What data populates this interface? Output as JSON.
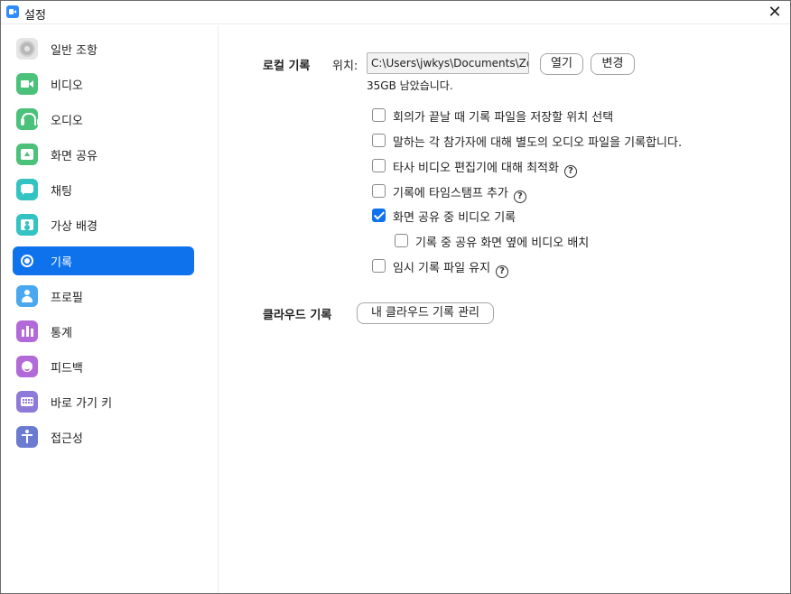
{
  "window": {
    "title": "설정",
    "close_glyph": "✕"
  },
  "sidebar": {
    "items": [
      {
        "label": "일반 조항",
        "icon": "gear-icon",
        "color": "#e5e5e5",
        "active": false
      },
      {
        "label": "비디오",
        "icon": "video-camera-icon",
        "color": "#4bc17a",
        "active": false
      },
      {
        "label": "오디오",
        "icon": "headphones-icon",
        "color": "#4bc17a",
        "active": false
      },
      {
        "label": "화면 공유",
        "icon": "share-screen-icon",
        "color": "#4bc17a",
        "active": false
      },
      {
        "label": "채팅",
        "icon": "chat-bubble-icon",
        "color": "#33c3c3",
        "active": false
      },
      {
        "label": "가상 배경",
        "icon": "virtual-background-icon",
        "color": "#33c3c3",
        "active": false
      },
      {
        "label": "기록",
        "icon": "record-icon",
        "color": "#0e72ed",
        "active": true
      },
      {
        "label": "프로필",
        "icon": "profile-icon",
        "color": "#4aa8f0",
        "active": false
      },
      {
        "label": "통계",
        "icon": "bar-chart-icon",
        "color": "#b26ad8",
        "active": false
      },
      {
        "label": "피드백",
        "icon": "smiley-icon",
        "color": "#b26ad8",
        "active": false
      },
      {
        "label": "바로 가기 키",
        "icon": "keyboard-icon",
        "color": "#8e7ad8",
        "active": false
      },
      {
        "label": "접근성",
        "icon": "accessibility-icon",
        "color": "#6b7bd1",
        "active": false
      }
    ]
  },
  "local_recording": {
    "section_label": "로컬 기록",
    "location_label": "위치:",
    "path_value": "C:\\Users\\jwkys\\Documents\\Zoom",
    "open_button": "열기",
    "change_button": "변경",
    "free_space": "35GB 남았습니다.",
    "options": [
      {
        "label": "회의가 끝날 때 기록 파일을 저장할 위치 선택",
        "checked": false,
        "help": false,
        "indent": false
      },
      {
        "label": "말하는 각 참가자에 대해 별도의 오디오 파일을 기록합니다.",
        "checked": false,
        "help": false,
        "indent": false
      },
      {
        "label": "타사 비디오 편집기에 대해 최적화",
        "checked": false,
        "help": true,
        "indent": false
      },
      {
        "label": "기록에 타임스탬프 추가",
        "checked": false,
        "help": true,
        "indent": false
      },
      {
        "label": "화면 공유 중 비디오 기록",
        "checked": true,
        "help": false,
        "indent": false
      },
      {
        "label": "기록 중 공유 화면 옆에 비디오 배치",
        "checked": false,
        "help": false,
        "indent": true
      },
      {
        "label": "임시 기록 파일 유지",
        "checked": false,
        "help": true,
        "indent": false
      }
    ]
  },
  "cloud_recording": {
    "section_label": "클라우드 기록",
    "manage_button": "내 클라우드 기록 관리"
  },
  "help_glyph": "?",
  "colors": {
    "accent": "#0e72ed"
  }
}
